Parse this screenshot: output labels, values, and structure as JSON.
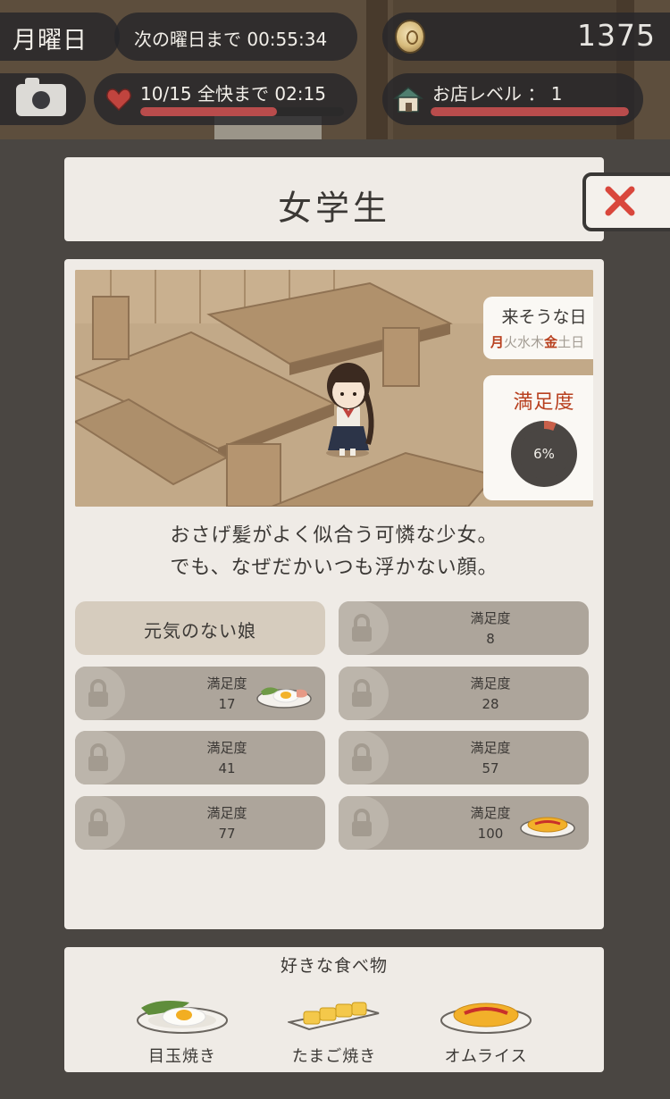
{
  "hud": {
    "day": "月曜日",
    "next_day": "次の曜日まで 00:55:34",
    "coins": "1375",
    "hearts": "10/15 全快まで 02:15",
    "hearts_fraction": 0.67,
    "shop_level": "お店レベル ： 1",
    "shop_fraction": 1.0
  },
  "character": {
    "name": "女学生",
    "description_line1": "おさげ髪がよく似合う可憐な少女。",
    "description_line2": "でも、なぜだかいつも浮かない顔。"
  },
  "visit_days": {
    "title": "来そうな日",
    "days": [
      {
        "label": "月",
        "active": true
      },
      {
        "label": "火",
        "active": false
      },
      {
        "label": "水",
        "active": false
      },
      {
        "label": "木",
        "active": false
      },
      {
        "label": "金",
        "active": true
      },
      {
        "label": "土",
        "active": false
      },
      {
        "label": "日",
        "active": false
      }
    ]
  },
  "satisfaction": {
    "title": "満足度",
    "percent_label": "6%",
    "percent": 6
  },
  "episodes": [
    {
      "unlocked": true,
      "name": "元気のない娘"
    },
    {
      "unlocked": false,
      "label": "満足度",
      "value": "8",
      "food": null
    },
    {
      "unlocked": false,
      "label": "満足度",
      "value": "17",
      "food": "fried-egg"
    },
    {
      "unlocked": false,
      "label": "満足度",
      "value": "28",
      "food": null
    },
    {
      "unlocked": false,
      "label": "満足度",
      "value": "41",
      "food": null
    },
    {
      "unlocked": false,
      "label": "満足度",
      "value": "57",
      "food": null
    },
    {
      "unlocked": false,
      "label": "満足度",
      "value": "77",
      "food": null
    },
    {
      "unlocked": false,
      "label": "満足度",
      "value": "100",
      "food": "omurice"
    }
  ],
  "favorite_foods": {
    "title": "好きな食べ物",
    "items": [
      {
        "name": "目玉焼き",
        "icon": "fried-egg"
      },
      {
        "name": "たまご焼き",
        "icon": "tamagoyaki"
      },
      {
        "name": "オムライス",
        "icon": "omurice"
      }
    ]
  },
  "colors": {
    "accent_red": "#b8401f",
    "bar_red": "#b94c4c",
    "panel": "#efebe6",
    "locked_slot": "#ada59b"
  }
}
